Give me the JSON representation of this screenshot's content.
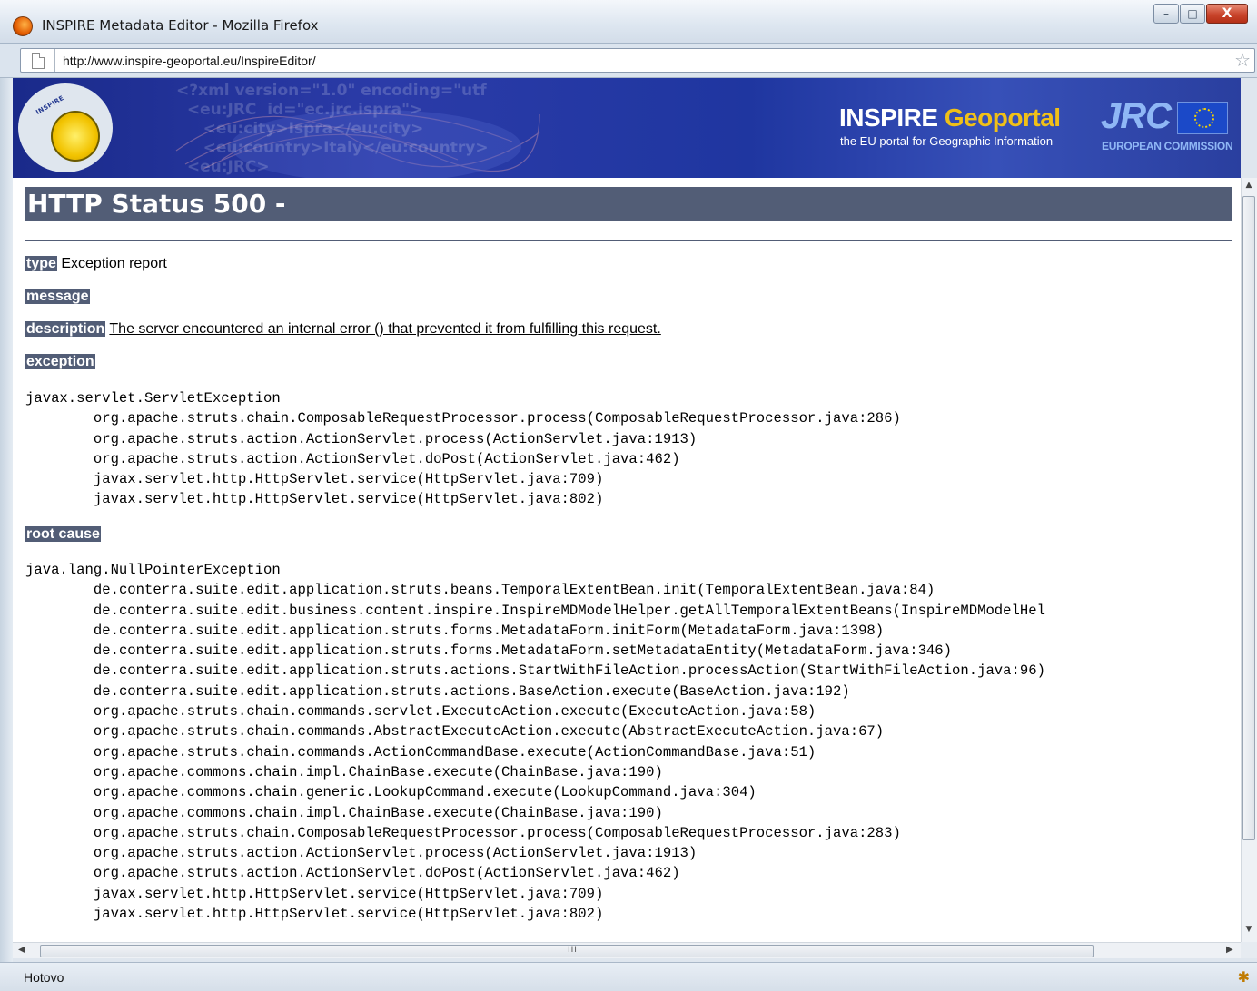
{
  "window": {
    "title": "INSPIRE Metadata Editor - Mozilla Firefox",
    "minimize": "–",
    "maximize": "□",
    "close": "X"
  },
  "address": {
    "url": "http://www.inspire-geoportal.eu/InspireEditor/"
  },
  "banner": {
    "logo_text": "INSPIRE",
    "brand_main": "INSPIRE ",
    "brand_accent": "Geoportal",
    "subtitle": "the EU portal for Geographic Information",
    "jrc": "JRC",
    "commission": "EUROPEAN COMMISSION",
    "xml_watermark": "<?xml version=\"1.0\" encoding=\"utf\n  <eu:JRC  id=\"ec.jrc.ispra\">\n     <eu:city>Ispra</eu:city>\n     <eu:country>Italy</eu:country>\n  <eu:JRC>"
  },
  "error": {
    "title": "HTTP Status 500 -",
    "type_label": "type",
    "type_value": "Exception report",
    "message_label": "message",
    "description_label": "description",
    "description_value": "The server encountered an internal error () that prevented it from fulfilling this request.",
    "exception_label": "exception",
    "exception_trace": "javax.servlet.ServletException\n\torg.apache.struts.chain.ComposableRequestProcessor.process(ComposableRequestProcessor.java:286)\n\torg.apache.struts.action.ActionServlet.process(ActionServlet.java:1913)\n\torg.apache.struts.action.ActionServlet.doPost(ActionServlet.java:462)\n\tjavax.servlet.http.HttpServlet.service(HttpServlet.java:709)\n\tjavax.servlet.http.HttpServlet.service(HttpServlet.java:802)",
    "root_cause_label": "root cause",
    "root_cause_trace": "java.lang.NullPointerException\n\tde.conterra.suite.edit.application.struts.beans.TemporalExtentBean.init(TemporalExtentBean.java:84)\n\tde.conterra.suite.edit.business.content.inspire.InspireMDModelHelper.getAllTemporalExtentBeans(InspireMDModelHel\n\tde.conterra.suite.edit.application.struts.forms.MetadataForm.initForm(MetadataForm.java:1398)\n\tde.conterra.suite.edit.application.struts.forms.MetadataForm.setMetadataEntity(MetadataForm.java:346)\n\tde.conterra.suite.edit.application.struts.actions.StartWithFileAction.processAction(StartWithFileAction.java:96)\n\tde.conterra.suite.edit.application.struts.actions.BaseAction.execute(BaseAction.java:192)\n\torg.apache.struts.chain.commands.servlet.ExecuteAction.execute(ExecuteAction.java:58)\n\torg.apache.struts.chain.commands.AbstractExecuteAction.execute(AbstractExecuteAction.java:67)\n\torg.apache.struts.chain.commands.ActionCommandBase.execute(ActionCommandBase.java:51)\n\torg.apache.commons.chain.impl.ChainBase.execute(ChainBase.java:190)\n\torg.apache.commons.chain.generic.LookupCommand.execute(LookupCommand.java:304)\n\torg.apache.commons.chain.impl.ChainBase.execute(ChainBase.java:190)\n\torg.apache.struts.chain.ComposableRequestProcessor.process(ComposableRequestProcessor.java:283)\n\torg.apache.struts.action.ActionServlet.process(ActionServlet.java:1913)\n\torg.apache.struts.action.ActionServlet.doPost(ActionServlet.java:462)\n\tjavax.servlet.http.HttpServlet.service(HttpServlet.java:709)\n\tjavax.servlet.http.HttpServlet.service(HttpServlet.java:802)"
  },
  "scrollbar": {
    "grip": "III"
  },
  "status": {
    "text": "Hotovo"
  },
  "colors": {
    "tomcat_header": "#525d76",
    "banner_blue": "#2b3ba8",
    "geoportal_accent": "#f0c018"
  }
}
